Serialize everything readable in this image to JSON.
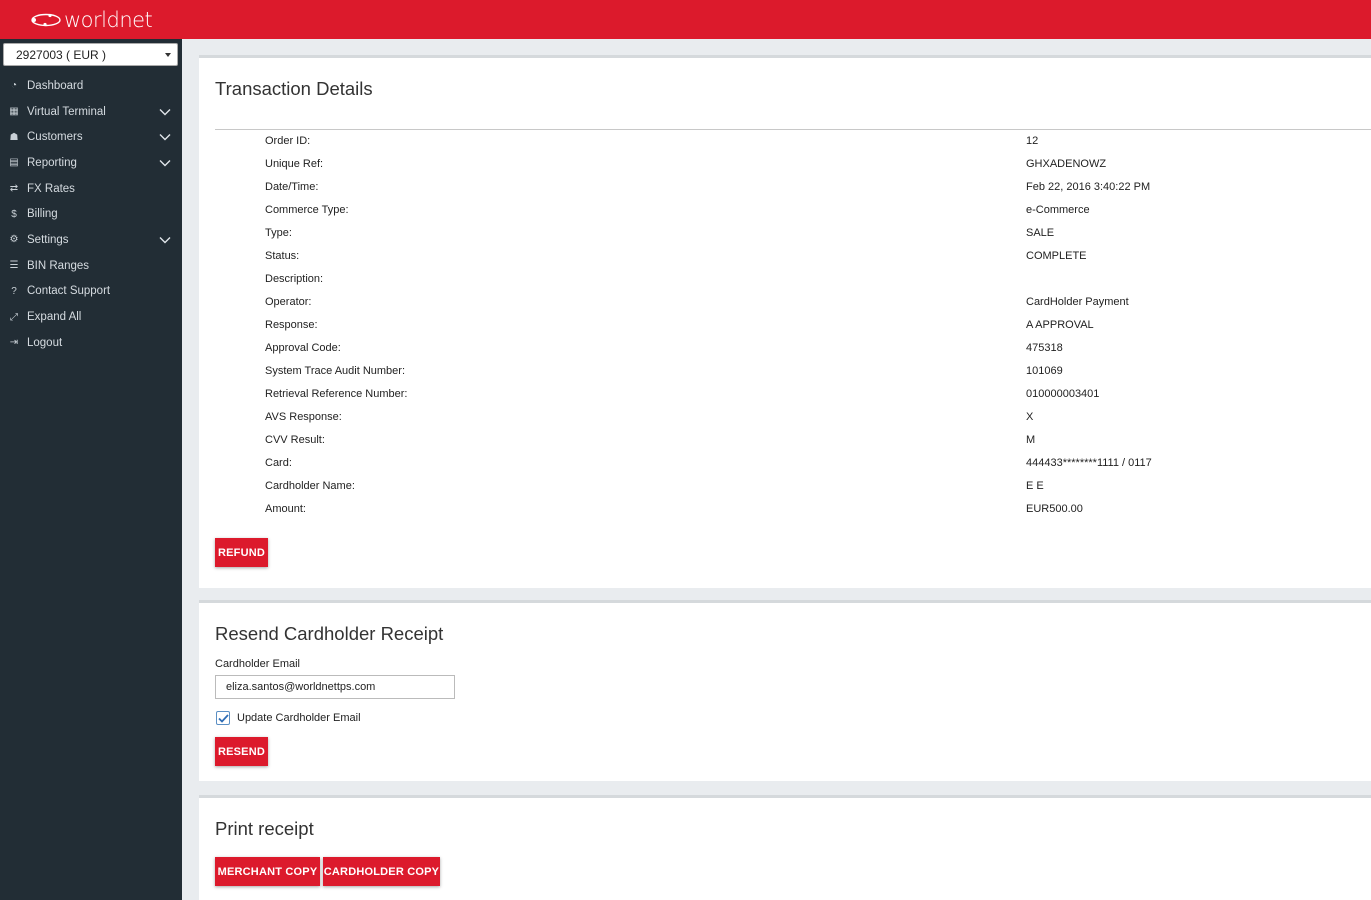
{
  "brand": {
    "logo_text": "worldnet"
  },
  "sidebar": {
    "merchant_select": "2927003 ( EUR )",
    "items": [
      {
        "label": "Dashboard",
        "icon": "dashboard-icon",
        "has_children": false
      },
      {
        "label": "Virtual Terminal",
        "icon": "calculator-icon",
        "has_children": true
      },
      {
        "label": "Customers",
        "icon": "users-icon",
        "has_children": true
      },
      {
        "label": "Reporting",
        "icon": "file-icon",
        "has_children": true
      },
      {
        "label": "FX Rates",
        "icon": "exchange-icon",
        "has_children": false
      },
      {
        "label": "Billing",
        "icon": "dollar-icon",
        "has_children": false
      },
      {
        "label": "Settings",
        "icon": "cogs-icon",
        "has_children": true
      },
      {
        "label": "BIN Ranges",
        "icon": "list-icon",
        "has_children": false
      },
      {
        "label": "Contact Support",
        "icon": "question-icon",
        "has_children": false
      },
      {
        "label": "Expand All",
        "icon": "expand-icon",
        "has_children": false
      },
      {
        "label": "Logout",
        "icon": "logout-icon",
        "has_children": false
      }
    ]
  },
  "transaction": {
    "title": "Transaction Details",
    "rows": [
      {
        "label": "Order ID:",
        "value": "12"
      },
      {
        "label": "Unique Ref:",
        "value": "GHXADENOWZ"
      },
      {
        "label": "Date/Time:",
        "value": "Feb 22, 2016 3:40:22 PM"
      },
      {
        "label": "Commerce Type:",
        "value": "e-Commerce"
      },
      {
        "label": "Type:",
        "value": "SALE"
      },
      {
        "label": "Status:",
        "value": "COMPLETE"
      },
      {
        "label": "Description:",
        "value": ""
      },
      {
        "label": "Operator:",
        "value": "CardHolder Payment"
      },
      {
        "label": "Response:",
        "value": "A APPROVAL"
      },
      {
        "label": "Approval Code:",
        "value": "475318"
      },
      {
        "label": "System Trace Audit Number:",
        "value": "101069"
      },
      {
        "label": "Retrieval Reference Number:",
        "value": "010000003401"
      },
      {
        "label": "AVS Response:",
        "value": "X"
      },
      {
        "label": "CVV Result:",
        "value": "M"
      },
      {
        "label": "Card:",
        "value": "444433********1111 / 0117"
      },
      {
        "label": "Cardholder Name:",
        "value": "E E"
      },
      {
        "label": "Amount:",
        "value": "EUR500.00"
      }
    ],
    "refund_label": "REFUND"
  },
  "resend": {
    "title": "Resend Cardholder Receipt",
    "email_label": "Cardholder Email",
    "email_value": "eliza.santos@worldnettps.com",
    "update_checkbox_label": "Update Cardholder Email",
    "update_checked": true,
    "resend_label": "RESEND"
  },
  "print": {
    "title": "Print receipt",
    "merchant_copy_label": "MERCHANT COPY",
    "cardholder_copy_label": "CARDHOLDER COPY"
  },
  "colors": {
    "brand_red": "#dc1a2c",
    "sidebar_bg": "#222d35",
    "page_bg": "#e9ecef"
  }
}
